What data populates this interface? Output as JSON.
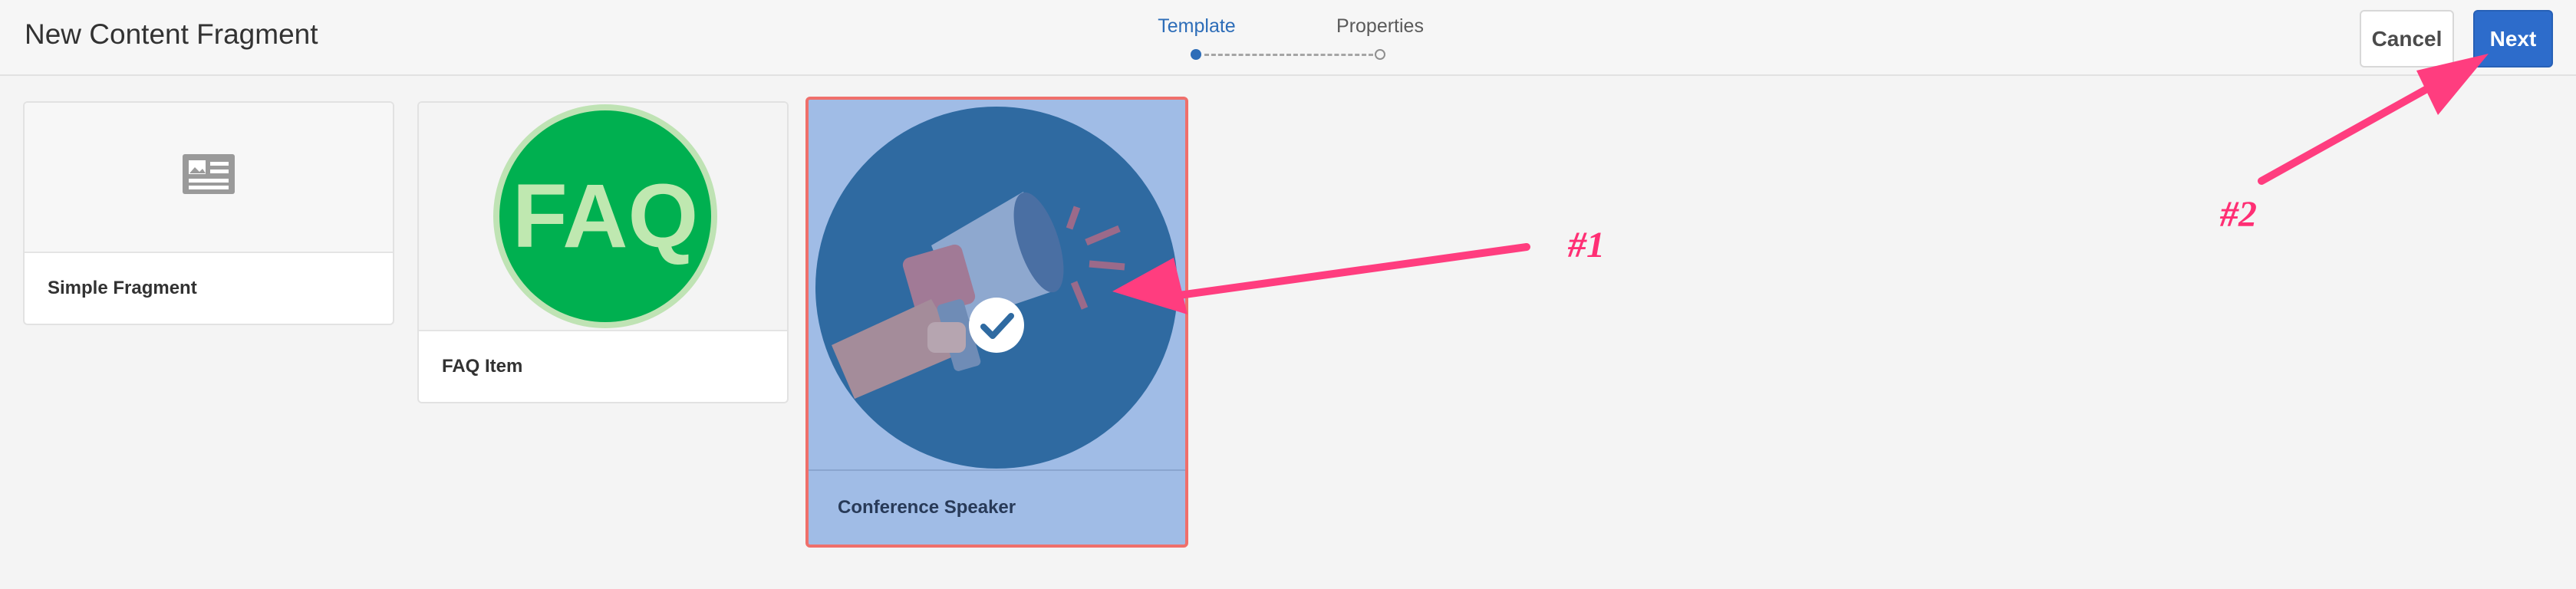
{
  "header": {
    "title": "New Content Fragment",
    "steps": [
      {
        "label": "Template",
        "state": "active"
      },
      {
        "label": "Properties",
        "state": "inactive"
      }
    ],
    "cancel_label": "Cancel",
    "next_label": "Next"
  },
  "templates": [
    {
      "label": "Simple Fragment",
      "icon": "fragment-card-icon",
      "selected": false
    },
    {
      "label": "FAQ Item",
      "icon": "faq-badge-icon",
      "thumb_text": "FAQ",
      "selected": false
    },
    {
      "label": "Conference Speaker",
      "icon": "megaphone-icon",
      "selected": true
    }
  ],
  "annotations": [
    {
      "label": "#1"
    },
    {
      "label": "#2"
    }
  ],
  "colors": {
    "accent": "#2d6ccb",
    "selection_overlay": "#a0bce6",
    "selection_border": "#ef6f6b",
    "annotation": "#ff2f74",
    "faq_green": "#00b050"
  }
}
